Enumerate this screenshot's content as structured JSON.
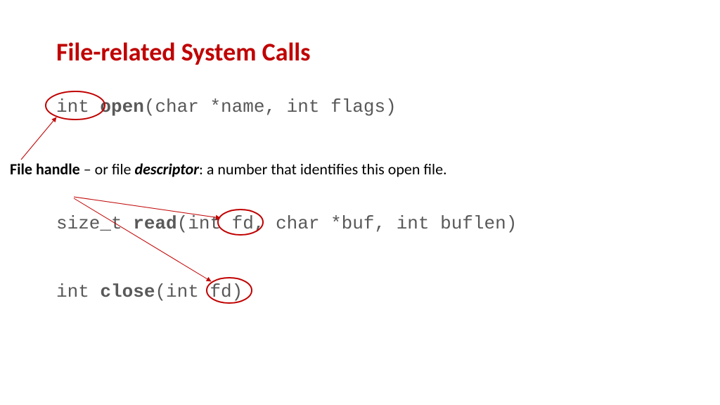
{
  "title": "File-related System Calls",
  "line1": {
    "pre": "int ",
    "bold": "open",
    "post": "(char *name, int flags)"
  },
  "desc": {
    "b1": "File handle",
    "t1": " – or file ",
    "i1": "descriptor",
    "t2": ": a number that identifies this open file."
  },
  "line2": {
    "pre": "size_t ",
    "bold": "read",
    "post": "(int fd, char *buf, int buflen)"
  },
  "line3": {
    "pre": "int ",
    "bold": "close",
    "post": "(int fd)"
  }
}
